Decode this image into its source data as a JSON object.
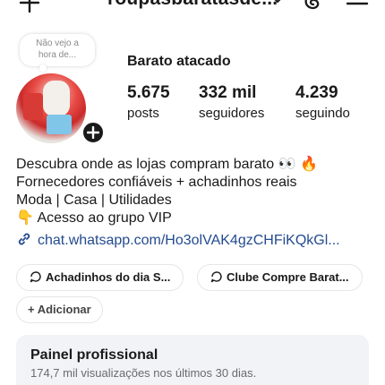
{
  "header": {
    "username": "roupasbaratasde...",
    "icons": [
      "plus-icon",
      "chevron-down-icon",
      "threads-icon",
      "menu-icon"
    ]
  },
  "note": {
    "text_line1": "Não vejo a",
    "text_line2": "hora de..."
  },
  "profile": {
    "display_name": "Barato atacado",
    "stats": [
      {
        "value": "5.675",
        "label": "posts"
      },
      {
        "value": "332 mil",
        "label": "seguidores"
      },
      {
        "value": "4.239",
        "label": "seguindo"
      }
    ]
  },
  "bio": {
    "line1": "Descubra onde as lojas compram barato 👀 🔥",
    "line2": "Fornecedores confiáveis + achadinhos reais",
    "line3": "Moda | Casa | Utilidades",
    "line4": "👇 Acesso ao grupo VIP",
    "link": "chat.whatsapp.com/Ho3olVAK4gzCHFiKQkGl..."
  },
  "chips": {
    "chip1": "Achadinhos do dia S...",
    "chip2": "Clube Compre Barat...",
    "add": "+ Adicionar"
  },
  "panel": {
    "title": "Painel profissional",
    "subtitle": "174,7 mil visualizações nos últimos 30 dias."
  },
  "colors": {
    "accent": "#234b8f",
    "badge": "#ff3040",
    "panel_bg": "#f1f3f6"
  }
}
